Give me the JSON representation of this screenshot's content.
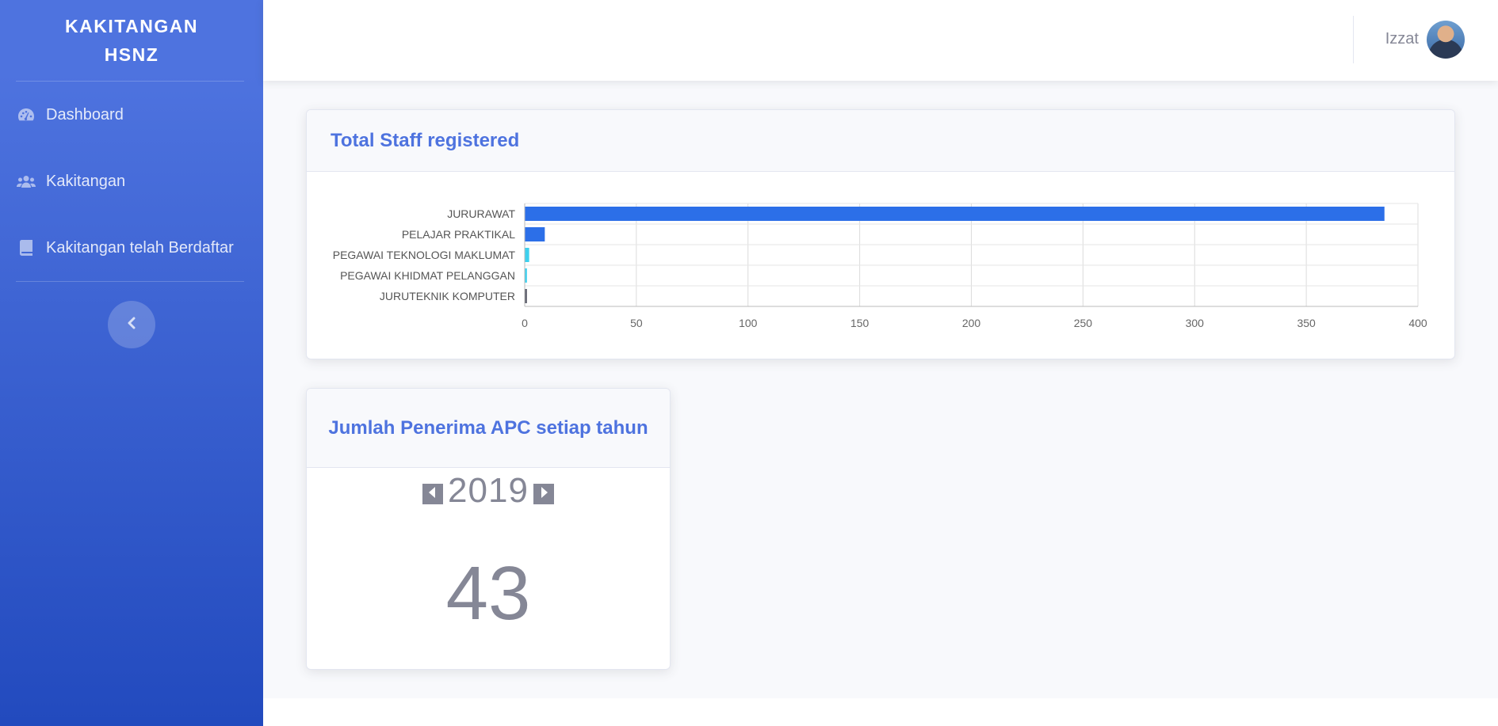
{
  "sidebar": {
    "brand_line1": "KAKITANGAN",
    "brand_line2": "HSNZ",
    "items": [
      {
        "label": "Dashboard",
        "icon": "tachometer-icon"
      },
      {
        "label": "Kakitangan",
        "icon": "users-icon"
      },
      {
        "label": "Kakitangan telah Berdaftar",
        "icon": "book-icon"
      }
    ],
    "toggle_icon": "chevron-left-icon"
  },
  "topbar": {
    "username": "Izzat",
    "avatar_icon": "user-avatar"
  },
  "chart_card": {
    "title": "Total Staff registered"
  },
  "chart_data": {
    "type": "bar",
    "orientation": "horizontal",
    "title": "",
    "xlabel": "",
    "ylabel": "",
    "categories": [
      "JURURAWAT",
      "PELAJAR PRAKTIKAL",
      "PEGAWAI TEKNOLOGI MAKLUMAT",
      "PEGAWAI KHIDMAT PELANGGAN",
      "JURUTEKNIK KOMPUTER"
    ],
    "values": [
      385,
      9,
      2,
      1,
      1
    ],
    "colors": [
      "#2c6fe8",
      "#2c6fe8",
      "#3dd0ee",
      "#3dd0ee",
      "#5a5c69"
    ],
    "xlim": [
      0,
      400
    ],
    "xticks": [
      0,
      50,
      100,
      150,
      200,
      250,
      300,
      350,
      400
    ],
    "grid": true,
    "legend": "none"
  },
  "apc_card": {
    "title": "Jumlah Penerima APC setiap tahun",
    "year": "2019",
    "count": "43",
    "prev_icon": "caret-left-icon",
    "next_icon": "caret-right-icon"
  }
}
